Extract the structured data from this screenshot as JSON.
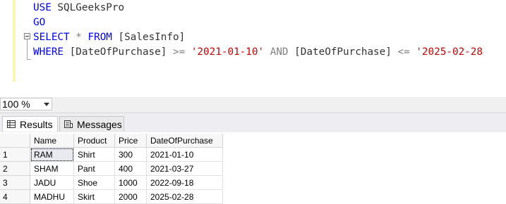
{
  "editor": {
    "lines": [
      {
        "parts": [
          {
            "t": "USE",
            "c": "kw"
          },
          {
            "t": " SQLGeeksPro",
            "c": "id"
          }
        ]
      },
      {
        "parts": [
          {
            "t": "GO",
            "c": "kw"
          }
        ]
      },
      {
        "parts": [
          {
            "t": "SELECT",
            "c": "kw"
          },
          {
            "t": " ",
            "c": "id"
          },
          {
            "t": "*",
            "c": "op"
          },
          {
            "t": " ",
            "c": "id"
          },
          {
            "t": "FROM",
            "c": "kw"
          },
          {
            "t": " [SalesInfo]",
            "c": "id"
          }
        ]
      },
      {
        "parts": [
          {
            "t": "WHERE",
            "c": "kw"
          },
          {
            "t": " [DateOfPurchase] ",
            "c": "id"
          },
          {
            "t": ">=",
            "c": "op"
          },
          {
            "t": " ",
            "c": "id"
          },
          {
            "t": "'2021-01-10'",
            "c": "str"
          },
          {
            "t": " ",
            "c": "id"
          },
          {
            "t": "AND",
            "c": "op"
          },
          {
            "t": " [DateOfPurchase] ",
            "c": "id"
          },
          {
            "t": "<=",
            "c": "op"
          },
          {
            "t": " ",
            "c": "id"
          },
          {
            "t": "'2025-02-28",
            "c": "str"
          }
        ]
      }
    ]
  },
  "zoom": {
    "value": "100 %"
  },
  "tabs": {
    "results": "Results",
    "messages": "Messages"
  },
  "grid": {
    "columns": [
      "Name",
      "Product",
      "Price",
      "DateOfPurchase"
    ],
    "rows": [
      {
        "num": "1",
        "cells": [
          "RAM",
          "Shirt",
          "300",
          "2021-01-10"
        ]
      },
      {
        "num": "2",
        "cells": [
          "SHAM",
          "Pant",
          "400",
          "2021-03-27"
        ]
      },
      {
        "num": "3",
        "cells": [
          "JADU",
          "Shoe",
          "1000",
          "2022-09-18"
        ]
      },
      {
        "num": "4",
        "cells": [
          "MADHU",
          "Skirt",
          "2000",
          "2025-02-28"
        ]
      }
    ]
  }
}
